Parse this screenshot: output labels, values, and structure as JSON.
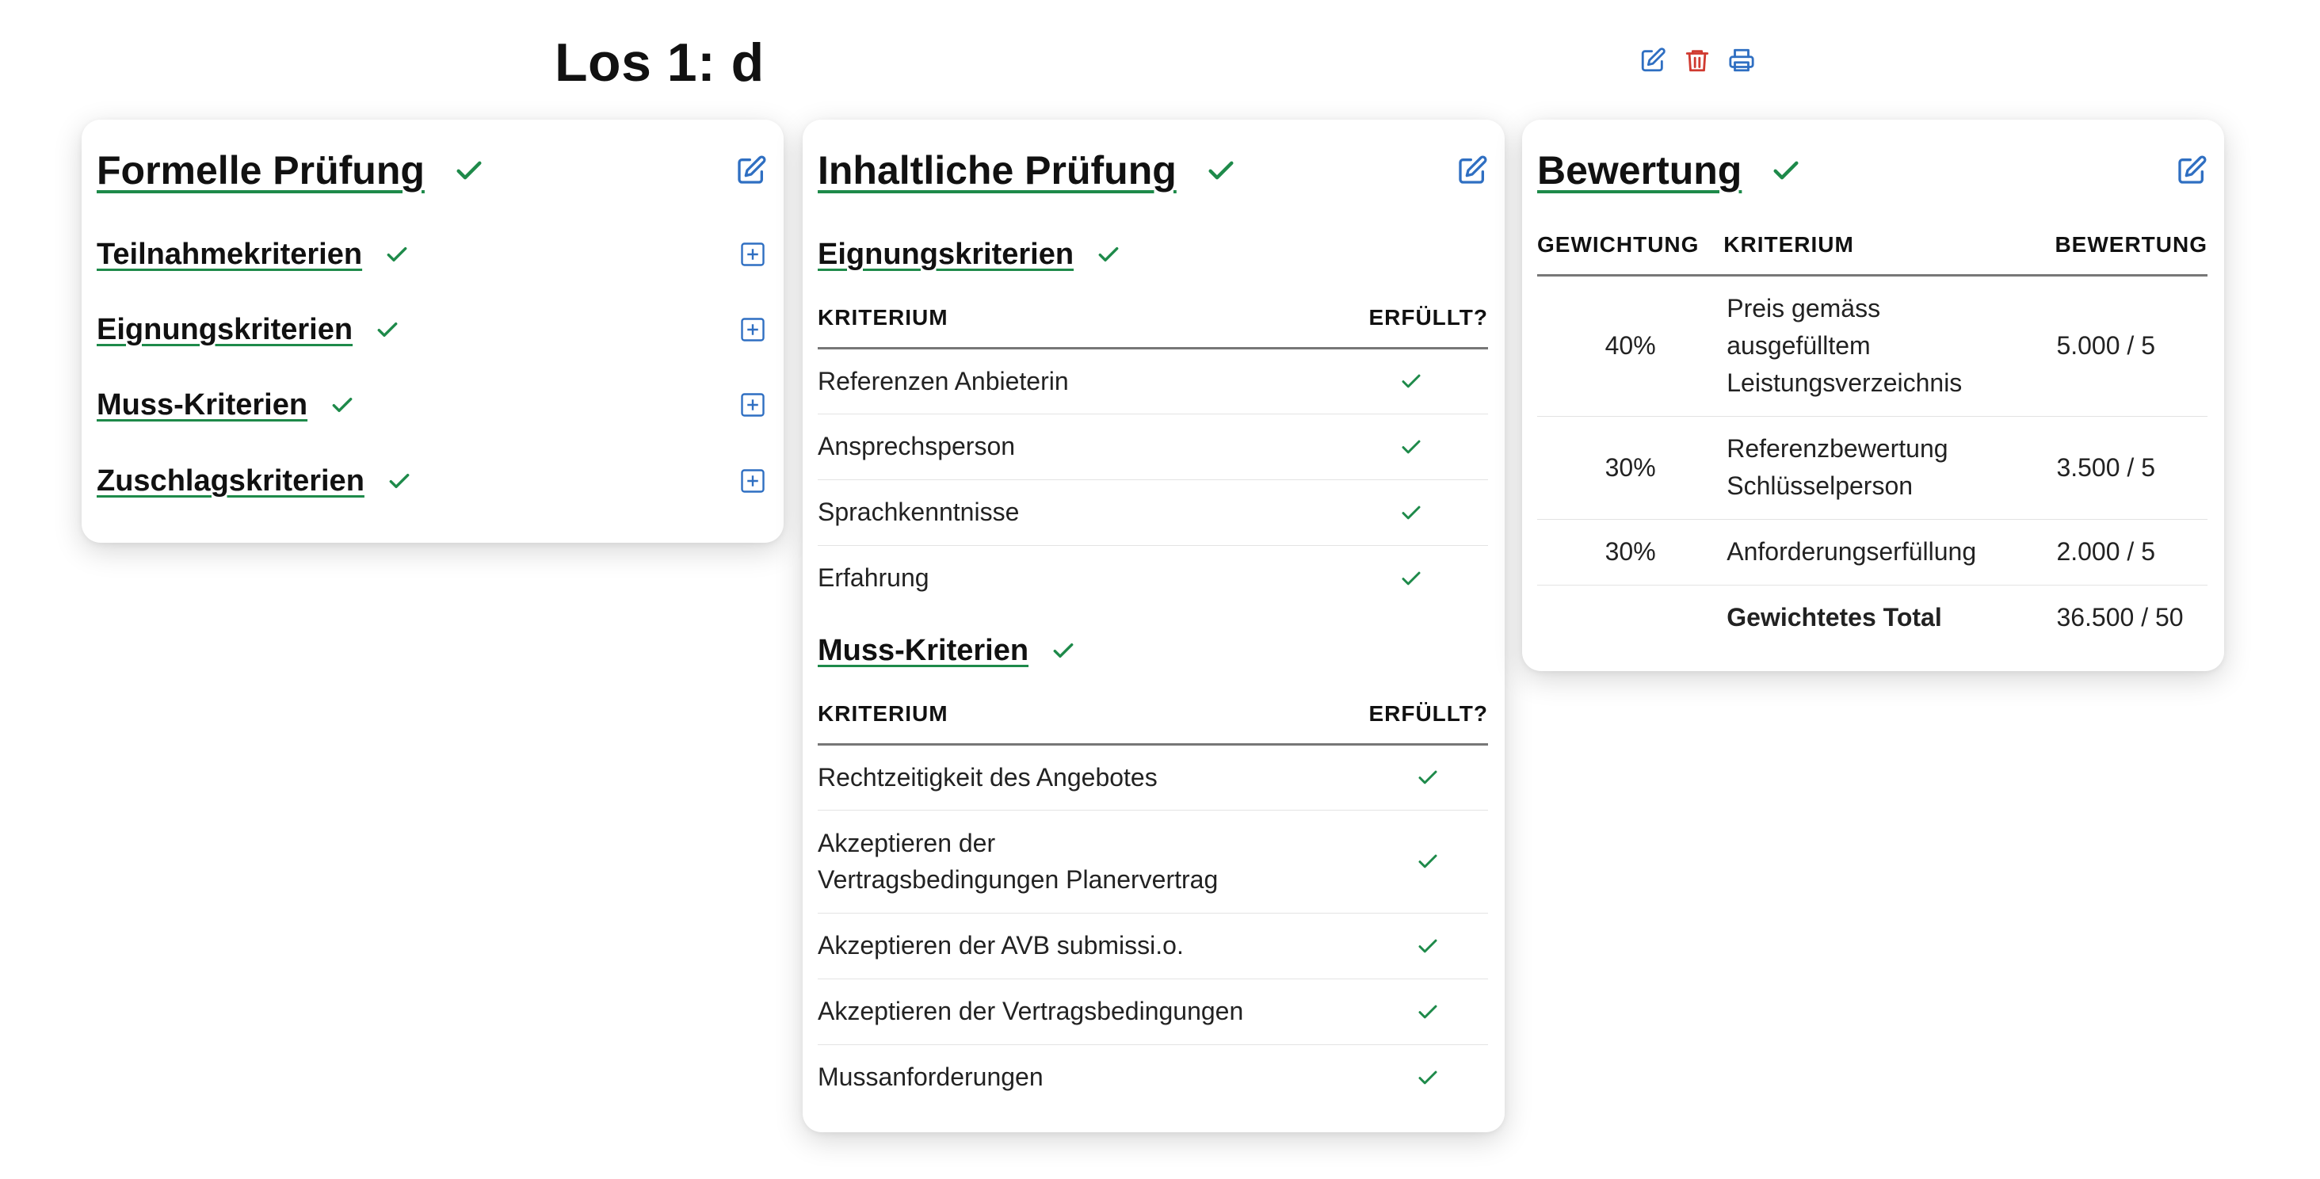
{
  "header": {
    "title": "Los 1: d"
  },
  "colors": {
    "accent_green": "#1e8a4a",
    "edit_blue": "#2f6fc2",
    "delete_red": "#d03a30"
  },
  "formal": {
    "title": "Formelle Prüfung",
    "sections": [
      {
        "label": "Teilnahmekriterien"
      },
      {
        "label": "Eignungskriterien"
      },
      {
        "label": "Muss-Kriterien"
      },
      {
        "label": "Zuschlagskriterien"
      }
    ]
  },
  "content": {
    "title": "Inhaltliche Prüfung",
    "eignung": {
      "title": "Eignungskriterien",
      "col_criterion": "KRITERIUM",
      "col_fulfilled": "ERFÜLLT?",
      "rows": [
        {
          "label": "Referenzen Anbieterin"
        },
        {
          "label": "Ansprechsperson"
        },
        {
          "label": "Sprachkenntnisse"
        },
        {
          "label": "Erfahrung"
        }
      ]
    },
    "muss": {
      "title": "Muss-Kriterien",
      "col_criterion": "KRITERIUM",
      "col_fulfilled": "ERFÜLLT?",
      "rows": [
        {
          "label": "Rechtzeitigkeit des Angebotes"
        },
        {
          "label": "Akzeptieren der Vertragsbedingungen Planervertrag"
        },
        {
          "label": "Akzeptieren der AVB submissi.o."
        },
        {
          "label": "Akzeptieren der Vertragsbedingungen"
        },
        {
          "label": "Mussanforderungen"
        }
      ]
    }
  },
  "rating": {
    "title": "Bewertung",
    "col_weight": "GEWICHTUNG",
    "col_criterion": "KRITERIUM",
    "col_rating": "BEWERTUNG",
    "rows": [
      {
        "weight": "40%",
        "criterion": "Preis gemäss ausgefülltem Leistungsverzeichnis",
        "score": "5.000 / 5"
      },
      {
        "weight": "30%",
        "criterion": "Referenzbewertung Schlüsselperson",
        "score": "3.500 / 5"
      },
      {
        "weight": "30%",
        "criterion": "Anforderungserfüllung",
        "score": "2.000 / 5"
      }
    ],
    "total_label": "Gewichtetes Total",
    "total_value": "36.500 / 50"
  }
}
